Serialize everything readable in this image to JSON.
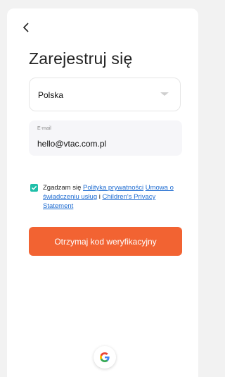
{
  "header": {
    "title": "Zarejestruj się"
  },
  "country": {
    "selected": "Polska"
  },
  "email": {
    "label": "E-mail",
    "value": "hello@vtac.com.pl"
  },
  "consent": {
    "checked": true,
    "prefix": "Zgadzam się ",
    "privacy_link": "Polityka prywatności",
    "terms_link": "Umowa o świadczeniu usług",
    "conjunction": " i ",
    "children_link": "Children's Privacy Statement"
  },
  "buttons": {
    "get_code": "Otrzymaj kod weryfikacyjny"
  },
  "icons": {
    "back": "chevron-left-icon",
    "dropdown": "caret-down-icon",
    "check": "check-icon",
    "google": "google-icon"
  },
  "colors": {
    "accent": "#f26332",
    "checkbox": "#1fbfa9",
    "link": "#1f6cd1"
  }
}
